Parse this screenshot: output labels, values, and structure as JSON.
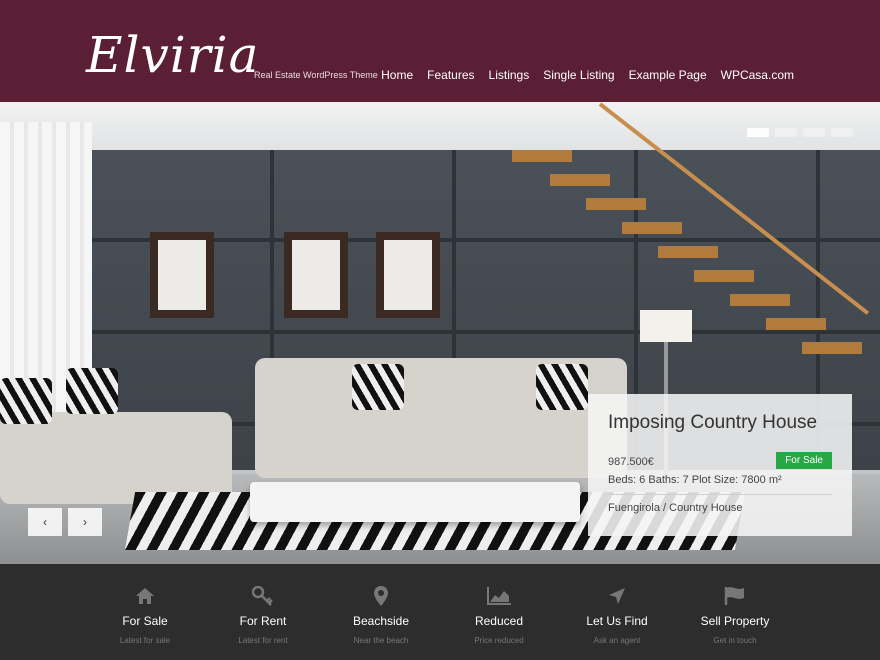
{
  "header": {
    "logo": "Elviria",
    "tagline": "Real Estate WordPress Theme",
    "nav": [
      "Home",
      "Features",
      "Listings",
      "Single Listing",
      "Example Page",
      "WPCasa.com"
    ]
  },
  "slider": {
    "prev": "‹",
    "next": "›",
    "pages": 4,
    "active_page": 1
  },
  "listing": {
    "title": "Imposing Country House",
    "price": "987.500€",
    "status": "For Sale",
    "details": "Beds: 6 Baths: 7 Plot Size: 7800 m²",
    "location": "Fuengirola / Country House"
  },
  "features": [
    {
      "icon": "home-icon",
      "label": "For Sale",
      "sub": "Latest for sale"
    },
    {
      "icon": "key-icon",
      "label": "For Rent",
      "sub": "Latest for rent"
    },
    {
      "icon": "map-marker-icon",
      "label": "Beachside",
      "sub": "Near the beach"
    },
    {
      "icon": "chart-icon",
      "label": "Reduced",
      "sub": "Price reduced"
    },
    {
      "icon": "location-arrow-icon",
      "label": "Let Us Find",
      "sub": "Ask an agent"
    },
    {
      "icon": "flag-icon",
      "label": "Sell Property",
      "sub": "Get in touch"
    }
  ],
  "colors": {
    "header": "#5a1f34",
    "footer": "#2d2d2d",
    "badge": "#28a745"
  }
}
